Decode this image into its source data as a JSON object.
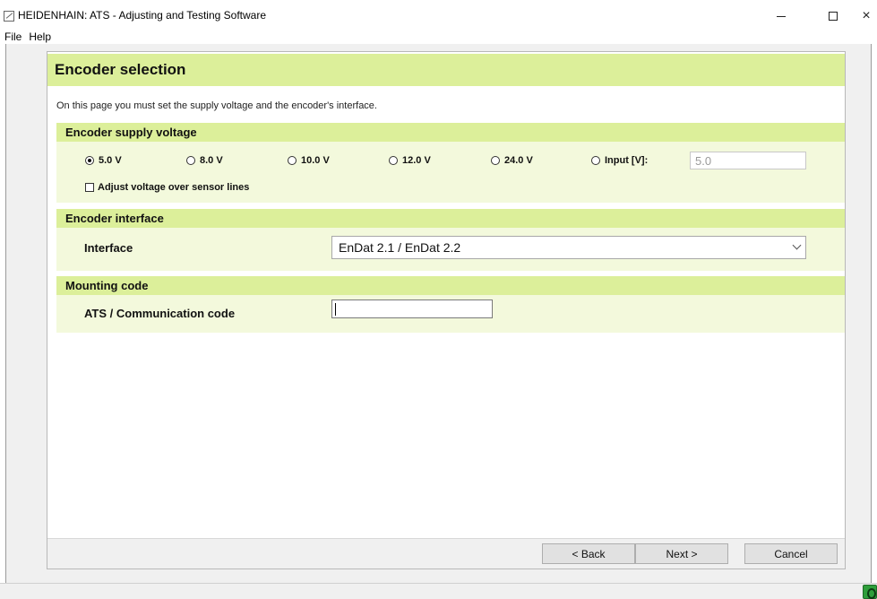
{
  "window": {
    "title": "HEIDENHAIN: ATS - Adjusting and Testing Software",
    "controls": {
      "minimize_icon": "minimize-icon",
      "maximize_icon": "maximize-icon",
      "close_glyph": "×"
    }
  },
  "menu": {
    "items": [
      "File",
      "Help"
    ]
  },
  "page": {
    "title": "Encoder selection",
    "intro": "On this page you must set the supply voltage and the encoder's interface."
  },
  "supply_voltage": {
    "heading": "Encoder supply voltage",
    "options": [
      "5.0 V",
      "8.0 V",
      "10.0 V",
      "12.0 V",
      "24.0 V",
      "Input [V]:"
    ],
    "selected": "5.0 V",
    "input_value": "5.0",
    "adjust_checkbox_label": "Adjust voltage over sensor lines",
    "adjust_checked": false
  },
  "interface": {
    "heading": "Encoder interface",
    "label": "Interface",
    "selected": "EnDat 2.1 / EnDat 2.2"
  },
  "mounting": {
    "heading": "Mounting code",
    "label": "ATS / Communication code",
    "value": ""
  },
  "buttons": {
    "back": "< Back",
    "next": "Next >",
    "cancel": "Cancel"
  },
  "colors": {
    "section_header": "#dcef9a",
    "section_body": "#f3f9dc",
    "status_icon": "#2f9e3b"
  },
  "icons": {
    "app": "heidenhain-app-icon",
    "status": "connection-status-icon"
  }
}
